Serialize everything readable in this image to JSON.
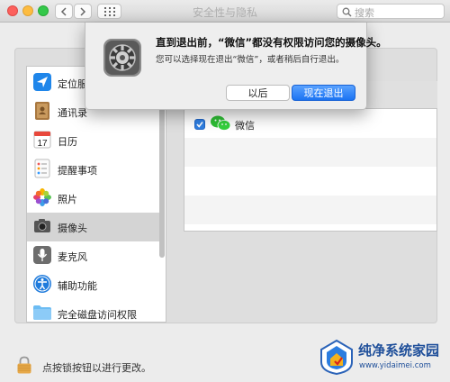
{
  "window": {
    "title": "安全性与隐私"
  },
  "toolbar": {
    "back_icon": "chevron-left-icon",
    "forward_icon": "chevron-right-icon",
    "grid_icon": "show-all-grid-icon",
    "search_placeholder": "搜索"
  },
  "sidebar": {
    "items": [
      {
        "label": "定位服务",
        "icon": "location-arrow-icon"
      },
      {
        "label": "通讯录",
        "icon": "contacts-book-icon"
      },
      {
        "label": "日历",
        "icon": "calendar-icon",
        "icon_text": "17"
      },
      {
        "label": "提醒事项",
        "icon": "reminders-list-icon"
      },
      {
        "label": "照片",
        "icon": "photos-flower-icon"
      },
      {
        "label": "摄像头",
        "icon": "camera-icon",
        "selected": true
      },
      {
        "label": "麦克风",
        "icon": "microphone-icon"
      },
      {
        "label": "辅助功能",
        "icon": "accessibility-icon"
      },
      {
        "label": "完全磁盘访问权限",
        "icon": "folder-icon"
      }
    ]
  },
  "app_list": {
    "rows": [
      {
        "name": "微信",
        "checked": true,
        "icon": "wechat-icon"
      }
    ]
  },
  "dialog": {
    "headline": "直到退出前，“微信”都没有权限访问您的摄像头。",
    "info": "您可以选择现在退出“微信”，或者稍后自行退出。",
    "later_label": "以后",
    "quit_label": "现在退出",
    "icon": "system-preferences-gear-icon"
  },
  "footer": {
    "lock_text": "点按锁按钮以进行更改。",
    "lock_icon": "padlock-icon"
  },
  "watermark": {
    "title": "纯净系统家园",
    "url": "www.yidaimei.com"
  },
  "colors": {
    "accent": "#1b73f2",
    "selection": "#d4d4d4"
  }
}
